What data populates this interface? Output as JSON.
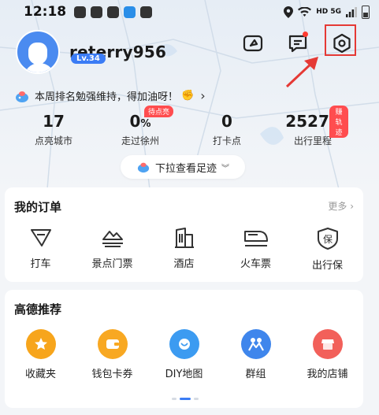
{
  "status_bar": {
    "time": "12:18",
    "network": "HD 5G"
  },
  "profile": {
    "username": "reterry956",
    "level": "Lv.34"
  },
  "rank_message": "本周排名勉强维持，得加油呀！",
  "stats": [
    {
      "value": "17",
      "label": "点亮城市",
      "badge": ""
    },
    {
      "value": "0",
      "unit": "%",
      "label": "走过徐州",
      "badge": "待点亮"
    },
    {
      "value": "0",
      "label": "打卡点",
      "badge": ""
    },
    {
      "value": "25276",
      "label": "出行里程",
      "badge": "赚轨迹"
    }
  ],
  "pull_tab": {
    "label": "下拉查看足迹"
  },
  "orders": {
    "title": "我的订单",
    "more": "更多",
    "items": [
      {
        "label": "打车",
        "icon": "taxi-icon"
      },
      {
        "label": "景点门票",
        "icon": "scenic-ticket-icon"
      },
      {
        "label": "酒店",
        "icon": "hotel-icon"
      },
      {
        "label": "火车票",
        "icon": "train-icon"
      },
      {
        "label": "出行保",
        "icon": "insurance-icon"
      }
    ]
  },
  "recommend": {
    "title": "高德推荐",
    "items": [
      {
        "label": "收藏夹",
        "icon": "star-icon",
        "color": "#f7a51c"
      },
      {
        "label": "钱包卡券",
        "icon": "wallet-icon",
        "color": "#f8a822"
      },
      {
        "label": "DIY地图",
        "icon": "diy-map-icon",
        "color": "#3c9bf1"
      },
      {
        "label": "群组",
        "icon": "group-icon",
        "color": "#3f86ec"
      },
      {
        "label": "我的店铺",
        "icon": "shop-icon",
        "color": "#f2605a"
      }
    ]
  },
  "colors": {
    "accent": "#3b7cf5",
    "highlight": "#e53935",
    "badge": "#ff4d4f"
  }
}
